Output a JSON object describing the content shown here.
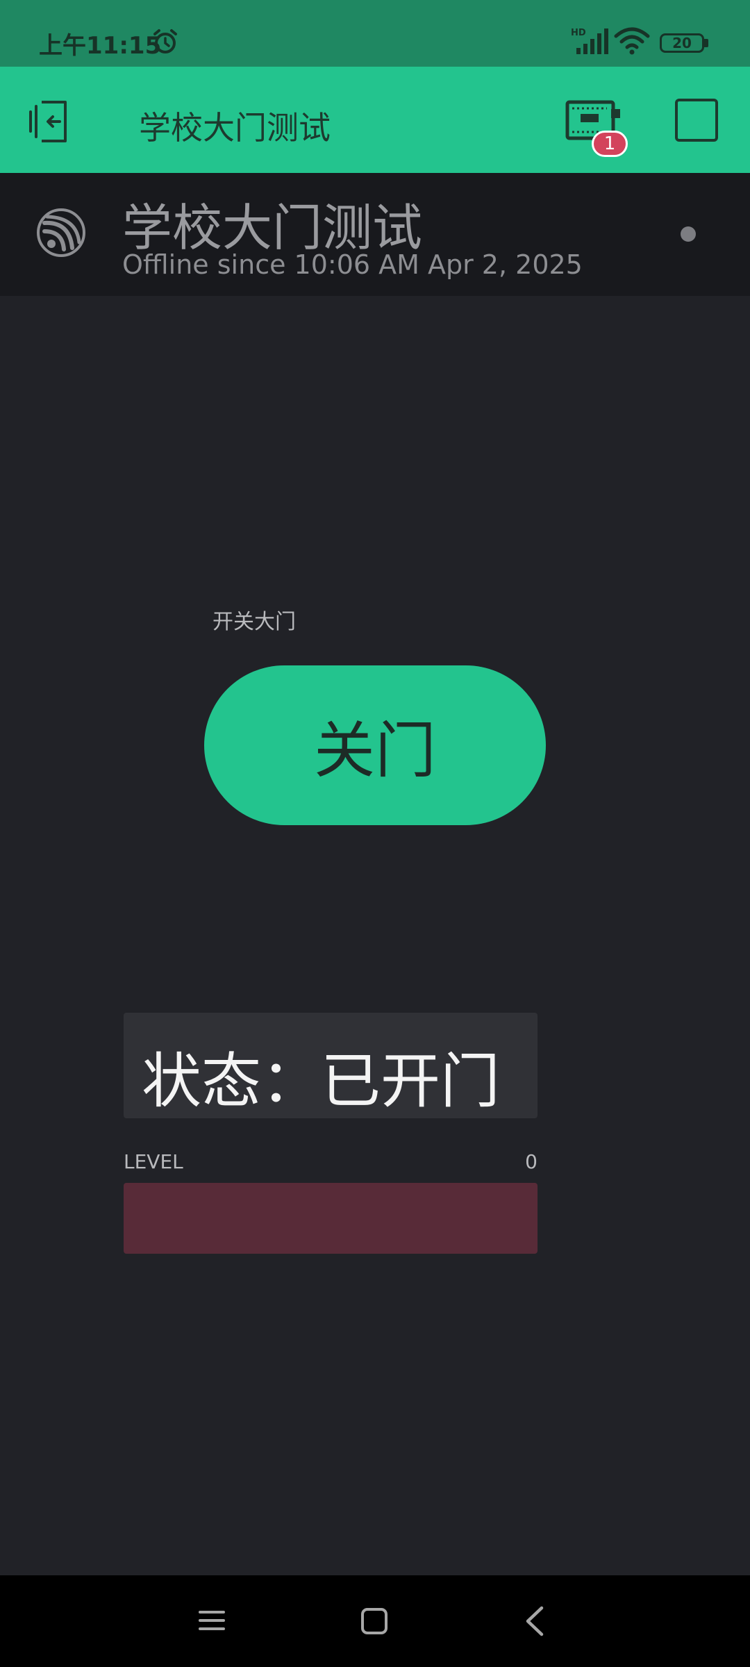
{
  "status_bar": {
    "time": "上午11:15",
    "network_label": "HD",
    "battery_level": "20"
  },
  "app_bar": {
    "title": "学校大门测试",
    "notification_count": "1"
  },
  "device_header": {
    "name": "学校大门测试",
    "status": "Offline since 10:06 AM Apr 2, 2025"
  },
  "gate_control": {
    "label": "开关大门",
    "button_label": "关门"
  },
  "status_display": {
    "text": "状态：已开门"
  },
  "level": {
    "label": "LEVEL",
    "value": "0",
    "fraction": 0
  },
  "colors": {
    "accent": "#23c48e",
    "status_bar": "#1f8862",
    "background": "#212227",
    "level_track": "#582b38",
    "badge": "#d3435c"
  },
  "icons": {
    "back": "exit-device-icon",
    "device": "device-board-icon",
    "stop": "square-icon",
    "board": "espressif-icon"
  }
}
